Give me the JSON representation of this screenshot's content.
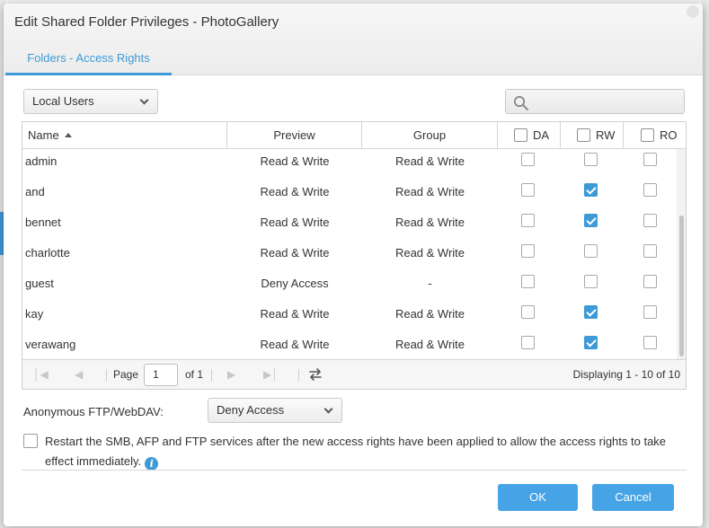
{
  "dialog": {
    "title": "Edit Shared Folder Privileges - PhotoGallery",
    "tab": "Folders - Access Rights"
  },
  "filter": {
    "selected": "Local Users"
  },
  "search": {
    "placeholder": ""
  },
  "grid": {
    "columns": {
      "name": "Name",
      "preview": "Preview",
      "group": "Group",
      "da": "DA",
      "rw": "RW",
      "ro": "RO"
    },
    "rows": [
      {
        "name": "admin",
        "preview": "Read & Write",
        "group": "Read & Write",
        "da": false,
        "rw": false,
        "ro": false
      },
      {
        "name": "and",
        "preview": "Read & Write",
        "group": "Read & Write",
        "da": false,
        "rw": true,
        "ro": false
      },
      {
        "name": "bennet",
        "preview": "Read & Write",
        "group": "Read & Write",
        "da": false,
        "rw": true,
        "ro": false
      },
      {
        "name": "charlotte",
        "preview": "Read & Write",
        "group": "Read & Write",
        "da": false,
        "rw": false,
        "ro": false
      },
      {
        "name": "guest",
        "preview": "Deny Access",
        "group": "-",
        "da": false,
        "rw": false,
        "ro": false
      },
      {
        "name": "kay",
        "preview": "Read & Write",
        "group": "Read & Write",
        "da": false,
        "rw": true,
        "ro": false
      },
      {
        "name": "verawang",
        "preview": "Read & Write",
        "group": "Read & Write",
        "da": false,
        "rw": true,
        "ro": false
      }
    ]
  },
  "pager": {
    "page_label": "Page",
    "page_value": "1",
    "of_label": "of 1",
    "displaying": "Displaying 1 - 10 of 10"
  },
  "anonymous": {
    "label": "Anonymous FTP/WebDAV:",
    "selected": "Deny Access"
  },
  "restart": {
    "text": "Restart the SMB, AFP and FTP services after the new access rights have been applied to allow the access rights to take effect immediately.",
    "checked": false
  },
  "buttons": {
    "ok": "OK",
    "cancel": "Cancel"
  },
  "colors": {
    "accent": "#3d9ad6",
    "button": "#46a3e6"
  },
  "icons": [
    "search-icon",
    "sort-ascending-icon",
    "first-page-icon",
    "prev-page-icon",
    "next-page-icon",
    "last-page-icon",
    "refresh-icon",
    "chevron-down-icon",
    "info-icon"
  ]
}
